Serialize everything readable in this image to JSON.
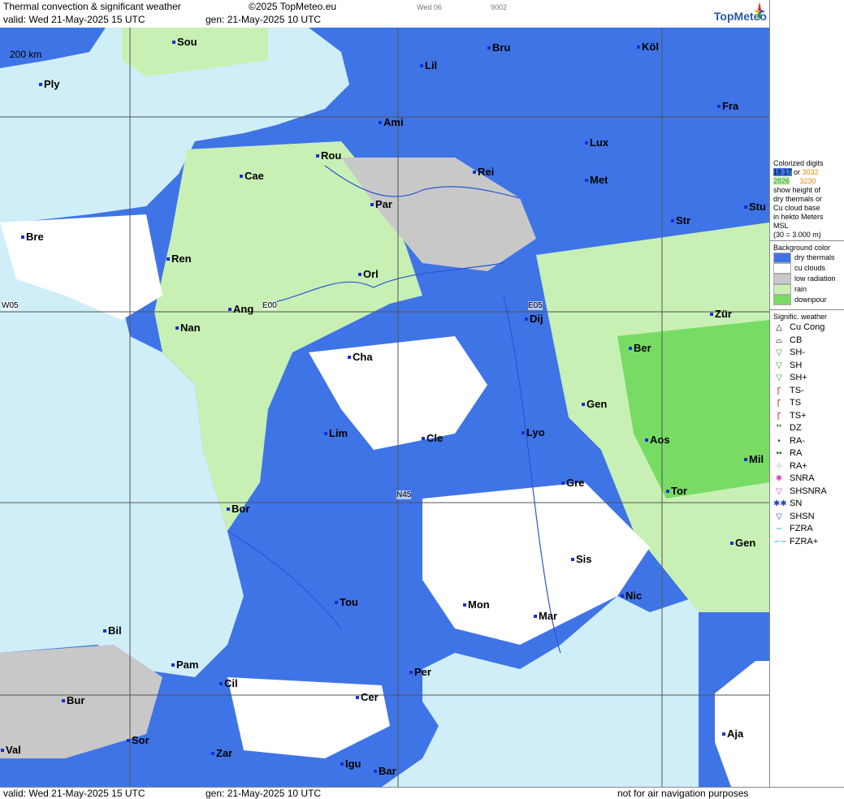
{
  "header": {
    "title": "Thermal convection & significant weather",
    "copyright": "©2025 TopMeteo.eu",
    "valid": "valid:  Wed  21-May-2025  15 UTC",
    "gen": "gen: 21-May-2025 10 UTC",
    "code1": "Wed 06",
    "code2": "9002",
    "logo": "TopMeteo"
  },
  "footer": {
    "valid": "valid:  Wed  21-May-2025  15 UTC",
    "gen": "gen: 21-May-2025 10 UTC",
    "note": "not for air navigation purposes"
  },
  "sidebar": {
    "digits_title": "Colorized digits",
    "digits_sample_a": "18 17",
    "digits_or": "or",
    "digits_sample_b": "3032",
    "digits_sample_c": "2826",
    "digits_sample_d": "3230",
    "digits_desc": [
      "show height of",
      "dry thermals or",
      "Cu cloud base",
      "in hekto Meters",
      "MSL",
      "(30 = 3.000 m)"
    ],
    "background_title": "Background color",
    "background_items": [
      {
        "label": "dry thermals",
        "color": "#3f74e6"
      },
      {
        "label": "cu clouds",
        "color": "#ffffff"
      },
      {
        "label": "low radiation",
        "color": "#c8c8c8"
      },
      {
        "label": "rain",
        "color": "#c8f0b4"
      },
      {
        "label": "downpour",
        "color": "#78dc64"
      }
    ],
    "weather_title": "Signific. weather",
    "weather_items": [
      {
        "symbol": "△",
        "label": "Cu Cong",
        "color": "#000000"
      },
      {
        "symbol": "⌓",
        "label": "CB",
        "color": "#000000"
      },
      {
        "symbol": "▽",
        "label": "SH-",
        "color": "#2a9a2a"
      },
      {
        "symbol": "▽",
        "label": "SH",
        "color": "#2a9a2a"
      },
      {
        "symbol": "▽",
        "label": "SH+",
        "color": "#2a9a2a"
      },
      {
        "symbol": "Ꞅ",
        "label": "TS-",
        "color": "#cc1010"
      },
      {
        "symbol": "Ꞅ",
        "label": "TS",
        "color": "#cc1010"
      },
      {
        "symbol": "Ꞅ",
        "label": "TS+",
        "color": "#cc1010"
      },
      {
        "symbol": "❜❜",
        "label": "DZ",
        "color": "#116611"
      },
      {
        "symbol": "•",
        "label": "RA-",
        "color": "#116611"
      },
      {
        "symbol": "••",
        "label": "RA",
        "color": "#116611"
      },
      {
        "symbol": "⁘",
        "label": "RA+",
        "color": "#116611"
      },
      {
        "symbol": "✱",
        "label": "SNRA",
        "color": "#cc44cc"
      },
      {
        "symbol": "▽",
        "label": "SHSNRA",
        "color": "#cc44cc"
      },
      {
        "symbol": "✱✱",
        "label": "SN",
        "color": "#2244cc"
      },
      {
        "symbol": "▽",
        "label": "SHSN",
        "color": "#2244cc"
      },
      {
        "symbol": "∽",
        "label": "FZRA",
        "color": "#22aacc"
      },
      {
        "symbol": "∽∽",
        "label": "FZRA+",
        "color": "#22aacc"
      }
    ]
  },
  "map": {
    "scale": "200 km",
    "grid_labels": [
      "W05",
      "E00",
      "E05",
      "N45"
    ],
    "cities": [
      "Sou",
      "Ply",
      "Lil",
      "Bru",
      "Köl",
      "Ami",
      "Fra",
      "Rou",
      "Lux",
      "Cae",
      "Rei",
      "Met",
      "Stu",
      "Par",
      "Str",
      "Bre",
      "Ren",
      "Orl",
      "Ang",
      "Nan",
      "Dij",
      "Zür",
      "Ber",
      "Cha",
      "Gen",
      "Lim",
      "Cle",
      "Lyo",
      "Aos",
      "Mil",
      "Gre",
      "Tor",
      "Bor",
      "Sis",
      "Gen",
      "Nic",
      "Tou",
      "Mon",
      "Mar",
      "Bil",
      "Pam",
      "Per",
      "Cil",
      "Bur",
      "Cer",
      "Sor",
      "Val",
      "Zar",
      "Igu",
      "Bar",
      "Aja"
    ]
  }
}
